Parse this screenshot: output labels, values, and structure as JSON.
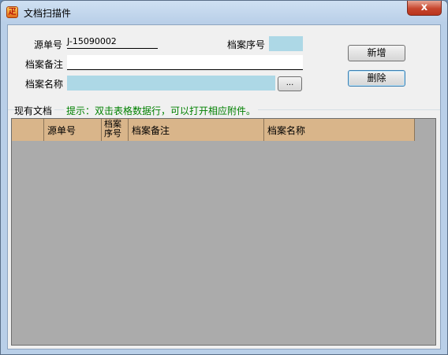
{
  "window": {
    "title": "文档扫描件",
    "app_icon_glyph": "疋",
    "close_glyph": "x"
  },
  "form": {
    "source_no_label": "源单号",
    "source_no_value": "J-15090002",
    "archive_seq_label": "档案序号",
    "archive_seq_value": "",
    "archive_note_label": "档案备注",
    "archive_note_value": "",
    "archive_name_label": "档案名称",
    "archive_name_value": "",
    "browse_label": "...",
    "field_highlight_color": "#add8e6"
  },
  "buttons": {
    "add_label": "新增",
    "delete_label": "删除"
  },
  "section": {
    "title": "现有文档",
    "hint": "提示：双击表格数据行，可以打开相应附件。",
    "hint_color": "#008000"
  },
  "grid": {
    "columns": [
      "",
      "源单号",
      "档案序号",
      "档案备注",
      "档案名称"
    ],
    "rows": [],
    "header_color": "#d9b58a",
    "background_color": "#ababab"
  }
}
